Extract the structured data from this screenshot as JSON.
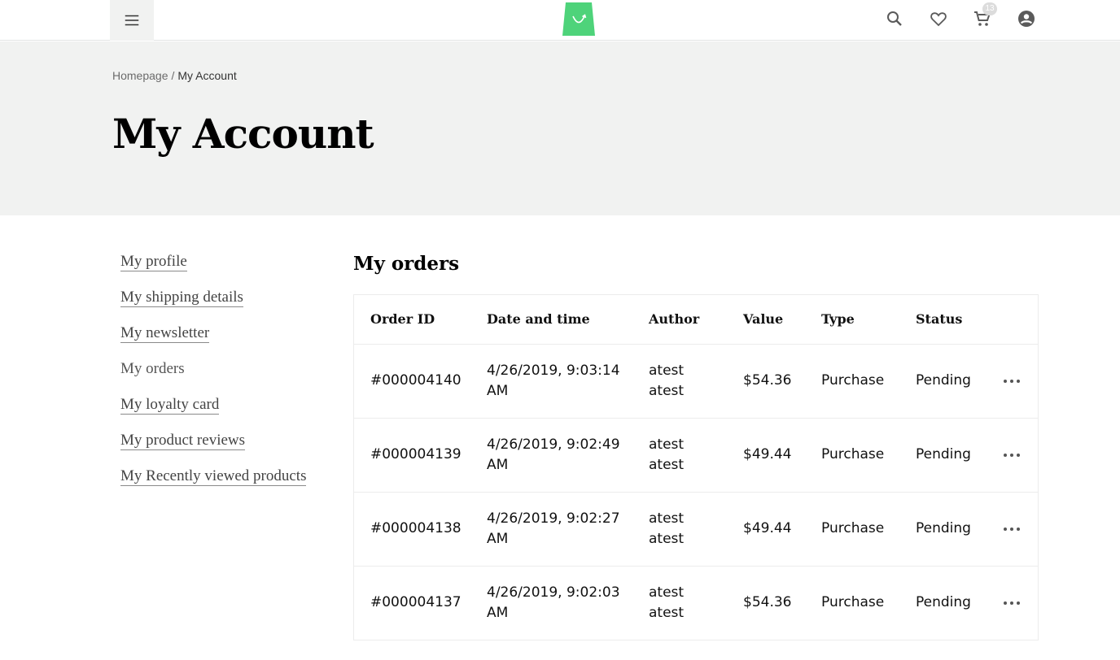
{
  "header": {
    "cart_count": "13"
  },
  "breadcrumb": {
    "home": "Homepage",
    "separator": "/",
    "current": "My Account"
  },
  "page_title": "My Account",
  "sidebar": {
    "items": [
      {
        "label": "My profile",
        "active": false
      },
      {
        "label": "My shipping details",
        "active": false
      },
      {
        "label": "My newsletter",
        "active": false
      },
      {
        "label": "My orders",
        "active": true
      },
      {
        "label": "My loyalty card",
        "active": false
      },
      {
        "label": "My product reviews",
        "active": false
      },
      {
        "label": "My Recently viewed products",
        "active": false
      }
    ]
  },
  "orders": {
    "title": "My orders",
    "columns": [
      "Order ID",
      "Date and time",
      "Author",
      "Value",
      "Type",
      "Status"
    ],
    "rows": [
      {
        "id": "#000004140",
        "date": "4/26/2019, 9:03:14",
        "time_suffix": "AM",
        "author_first": "atest",
        "author_last": "atest",
        "value": "$54.36",
        "type": "Purchase",
        "status": "Pending"
      },
      {
        "id": "#000004139",
        "date": "4/26/2019, 9:02:49",
        "time_suffix": "AM",
        "author_first": "atest",
        "author_last": "atest",
        "value": "$49.44",
        "type": "Purchase",
        "status": "Pending"
      },
      {
        "id": "#000004138",
        "date": "4/26/2019, 9:02:27",
        "time_suffix": "AM",
        "author_first": "atest",
        "author_last": "atest",
        "value": "$49.44",
        "type": "Purchase",
        "status": "Pending"
      },
      {
        "id": "#000004137",
        "date": "4/26/2019, 9:02:03",
        "time_suffix": "AM",
        "author_first": "atest",
        "author_last": "atest",
        "value": "$54.36",
        "type": "Purchase",
        "status": "Pending"
      }
    ]
  },
  "icons": {
    "menu": "hamburger-icon",
    "logo": "shopping-bag-icon",
    "search": "search-icon",
    "wishlist": "heart-icon",
    "cart": "cart-icon",
    "account": "account-circle-icon",
    "row_actions": "more-horizontal-icon"
  },
  "colors": {
    "logo_green": "#4ed37a",
    "hero_bg": "#f1f2f1"
  }
}
